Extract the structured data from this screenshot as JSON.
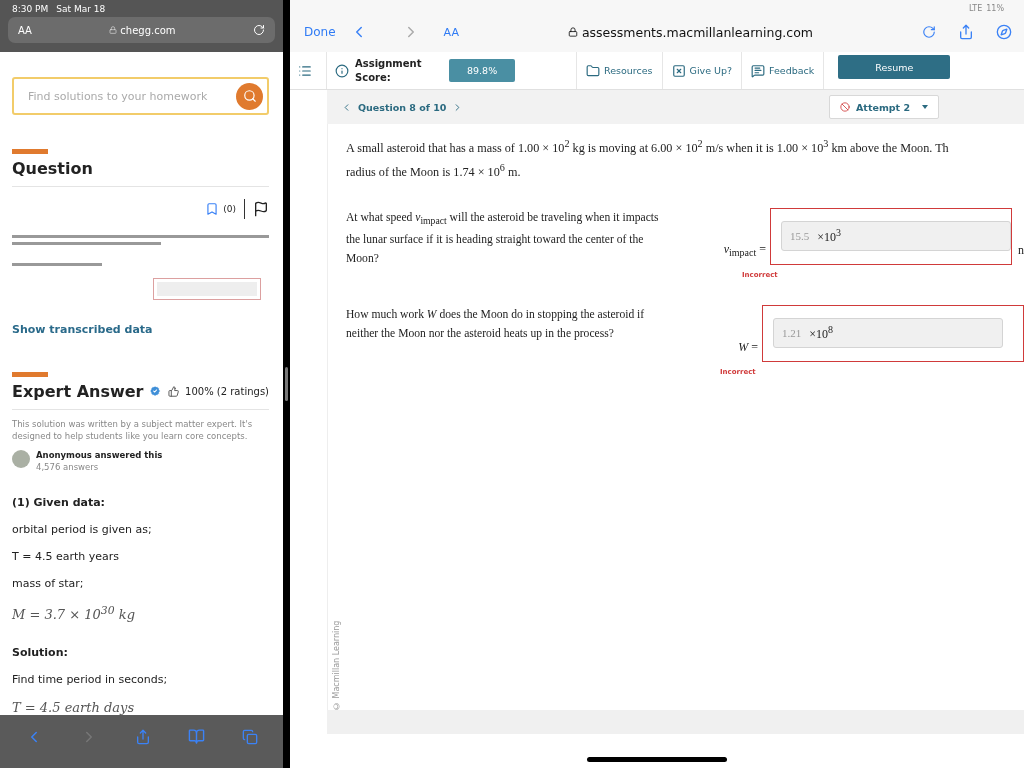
{
  "left_status": {
    "time": "8:30 PM",
    "date": "Sat Mar 18"
  },
  "left_browser": {
    "text_size": "AA",
    "url": "chegg.com"
  },
  "search": {
    "placeholder": "Find solutions to your homework"
  },
  "question": {
    "heading": "Question",
    "bookmark_count": "(0)"
  },
  "show_transcribed": "Show transcribed data",
  "expert": {
    "heading": "Expert Answer",
    "rating": "100% (2 ratings)",
    "note": "This solution was written by a subject matter expert. It's designed to help students like you learn core concepts.",
    "author": "Anonymous answered this",
    "answers": "4,576 answers"
  },
  "solution": [
    {
      "kind": "heading",
      "text": "(1) Given data:"
    },
    {
      "kind": "text",
      "text": "orbital period is given as;"
    },
    {
      "kind": "text",
      "text": "T = 4.5 earth years"
    },
    {
      "kind": "text",
      "text": "mass of star;"
    },
    {
      "kind": "math",
      "text": "M = 3.7 × 10$^{30}$ kg"
    },
    {
      "kind": "heading",
      "text": "Solution:"
    },
    {
      "kind": "text",
      "text": "Find time period in seconds;"
    },
    {
      "kind": "math",
      "text": "T = 4.5 earth days"
    }
  ],
  "right_status": {
    "network": "LTE",
    "battery": "11%"
  },
  "right_browser": {
    "done": "Done",
    "text_size": "AA",
    "url": "assessments.macmillanlearning.com"
  },
  "toolbar": {
    "score_label": "Assignment Score:",
    "score": "89.8%",
    "actions": [
      {
        "label": "Resources"
      },
      {
        "label": "Give Up?"
      },
      {
        "label": "Feedback"
      }
    ],
    "resume": "Resume"
  },
  "question_nav": {
    "label": "Question 8 of 10",
    "attempt": "Attempt 2"
  },
  "copyright": "© Macmillan Learning",
  "problem": [
    "A small asteroid that has a mass of 1.00 × 10$^{2}$ kg is moving at 6.00 × 10$^{2}$ m/s when it is 1.00 × 10$^{3}$ km above the Moon. Th",
    "radius of the Moon is 1.74 × 10$^{6}$ m."
  ],
  "parts": [
    {
      "prompt": "At what speed *v*$_{impact}$ will the asteroid be traveling when it impacts the lunar surface if it is heading straight toward the center of the Moon?",
      "answer_label": "*v*$_{impact}$ =",
      "value": "15.5",
      "exponent": "×10$^{3}$",
      "unit": "n",
      "status": "Incorrect",
      "correct": false
    },
    {
      "prompt": "How much work *W* does the Moon do in stopping the asteroid if neither the Moon nor the asteroid heats up in the process?",
      "answer_label": "*W* =",
      "value": "1.21",
      "exponent": "×10$^{8}$",
      "status": "Incorrect",
      "correct": false
    }
  ]
}
